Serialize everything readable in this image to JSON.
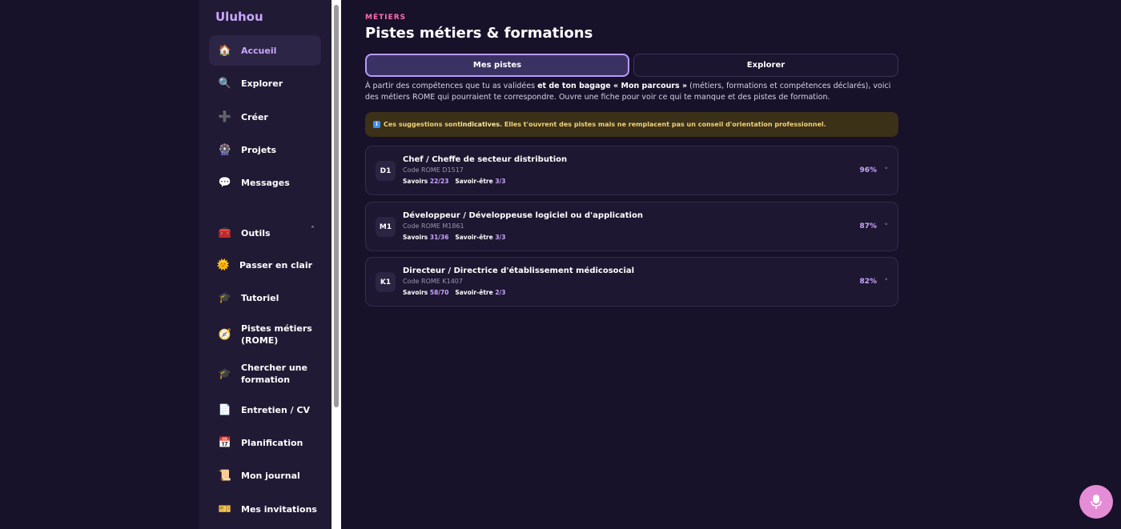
{
  "sidebar": {
    "brand": "Uluhou",
    "items": [
      {
        "label": "Accueil",
        "icon": "🏠",
        "icon_name": "home-icon",
        "active": true
      },
      {
        "label": "Explorer",
        "icon": "🔍",
        "icon_name": "search-icon"
      },
      {
        "label": "Créer",
        "icon": "➕",
        "icon_name": "plus-icon"
      },
      {
        "label": "Projets",
        "icon": "🎡",
        "icon_name": "projects-icon"
      },
      {
        "label": "Messages",
        "icon": "💬",
        "icon_name": "chat-bubble-icon"
      }
    ],
    "tools": {
      "label": "Outils",
      "icon": "🧰",
      "icon_name": "toolbox-icon",
      "chevron": "˄",
      "items": [
        {
          "label": "Passer en clair",
          "icon": "🌞",
          "icon_name": "sun-icon"
        },
        {
          "label": "Tutoriel",
          "icon": "🎓",
          "icon_name": "graduation-cap-icon"
        },
        {
          "label": "Pistes métiers (ROME)",
          "icon": "🧭",
          "icon_name": "compass-icon"
        },
        {
          "label": "Chercher une formation",
          "icon": "🎓",
          "icon_name": "graduation-cap-icon"
        },
        {
          "label": "Entretien / CV",
          "icon": "📄",
          "icon_name": "document-icon"
        },
        {
          "label": "Planification",
          "icon": "📅",
          "icon_name": "calendar-icon"
        },
        {
          "label": "Mon journal",
          "icon": "📜",
          "icon_name": "scroll-icon"
        },
        {
          "label": "Mes invitations",
          "icon": "🎫",
          "icon_name": "ticket-icon"
        }
      ]
    }
  },
  "main": {
    "eyebrow": "MÉTIERS",
    "title": "Pistes métiers & formations",
    "tabs": [
      {
        "label": "Mes pistes",
        "active": true
      },
      {
        "label": "Explorer",
        "active": false
      }
    ],
    "intro": {
      "part1": "À partir des compétences que tu as validées ",
      "bold": "et de ton bagage « Mon parcours »",
      "part2": " (métiers, formations et compétences déclarés), voici des métiers ROME qui pourraient te correspondre. Ouvre une fiche pour voir ce qui te manque et des pistes de formation."
    },
    "notice": {
      "icon": "ℹ",
      "part1": "Ces suggestions sont ",
      "bold": "indicatives",
      "part2": ". Elles t'ouvrent des pistes mais ne remplacent pas un conseil d'orientation professionnel."
    },
    "cards": [
      {
        "badge": "D1",
        "title": "Chef / Cheffe de secteur distribution",
        "code": "Code ROME D1517",
        "savoirs_label": "Savoirs",
        "savoirs": "22/23",
        "savoir_etre_label": "Savoir-être",
        "savoir_etre": "3/3",
        "match": "96%"
      },
      {
        "badge": "M1",
        "title": "Développeur / Développeuse logiciel ou d'application",
        "code": "Code ROME M1861",
        "savoirs_label": "Savoirs",
        "savoirs": "31/36",
        "savoir_etre_label": "Savoir-être",
        "savoir_etre": "3/3",
        "match": "87%"
      },
      {
        "badge": "K1",
        "title": "Directeur / Directrice d'établissement médicosocial",
        "code": "Code ROME K1407",
        "savoirs_label": "Savoirs",
        "savoirs": "58/70",
        "savoir_etre_label": "Savoir-être",
        "savoir_etre": "2/3",
        "match": "82%"
      }
    ],
    "chevron": "˅"
  },
  "fab": {
    "icon": "🎙",
    "icon_name": "microphone-icon"
  },
  "colors": {
    "accent": "#c9a6ff",
    "eyebrow": "#ff6fb0",
    "notice_bg": "#3b3018",
    "fab": "#e58cd6"
  }
}
